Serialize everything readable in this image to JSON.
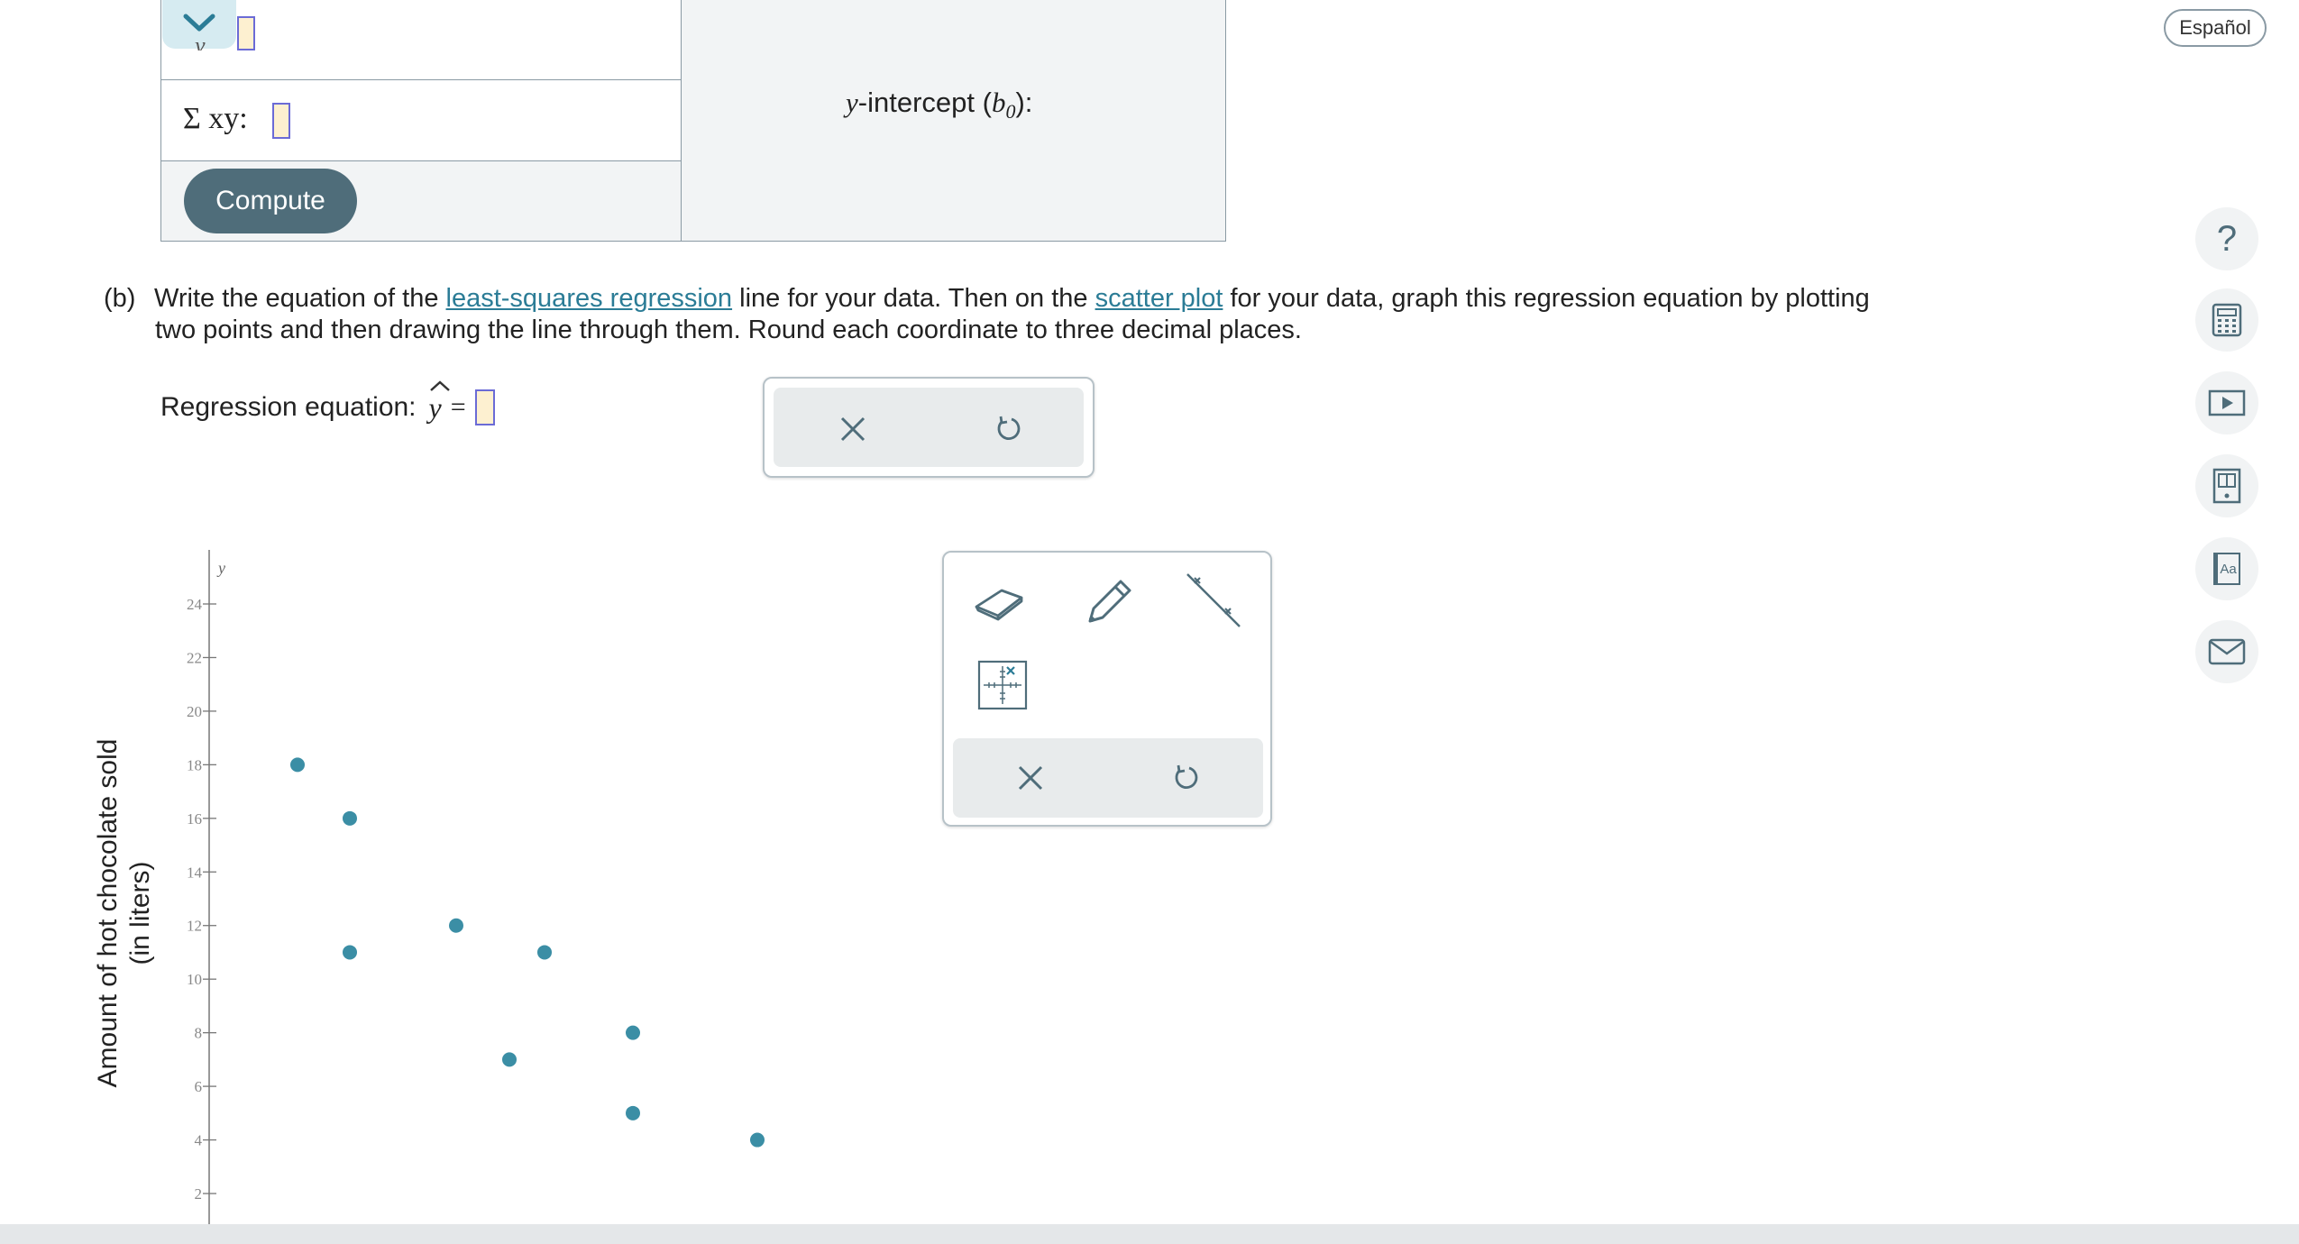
{
  "table": {
    "row1_label_partial": "y",
    "row2_label": "Σ xy:",
    "compute_label": "Compute",
    "intercept_label_prefix": "y",
    "intercept_label_mid": "-intercept (",
    "intercept_label_b": "b",
    "intercept_label_sub": "0",
    "intercept_label_suffix": "):"
  },
  "language_button": "Español",
  "question": {
    "part_label": "(b)",
    "text_before_link1": "Write the equation of the ",
    "link1": "least-squares regression",
    "text_between": " line for your data. Then on the ",
    "link2": "scatter plot",
    "text_after_line1": " for your data, graph this regression equation by plotting",
    "text_line2": "two points and then drawing the line through them. Round each coordinate to three decimal places."
  },
  "regression": {
    "label": "Regression equation:",
    "yhat": "y",
    "equals": "="
  },
  "chart_data": {
    "type": "scatter",
    "ylabel_line1": "Amount of hot chocolate sold",
    "ylabel_line2": "(in liters)",
    "y_axis_var": "y",
    "yticks": [
      2,
      4,
      6,
      8,
      10,
      12,
      14,
      16,
      18,
      20,
      22,
      24
    ],
    "ylim": [
      1,
      26
    ],
    "points_screen_x": [
      330,
      388,
      388,
      506,
      565,
      604,
      702,
      702,
      840
    ],
    "points": [
      18,
      16,
      11,
      12,
      7,
      11,
      8,
      5,
      4
    ],
    "point_color": "#3b8ea5"
  },
  "sidebar": {
    "help": "?",
    "icons": [
      "calculator-icon",
      "video-icon",
      "textbook-icon",
      "glossary-icon",
      "mail-icon"
    ],
    "glossary_text": "Aa"
  },
  "colors": {
    "accent": "#2b7c96",
    "button": "#4f6d7a"
  }
}
